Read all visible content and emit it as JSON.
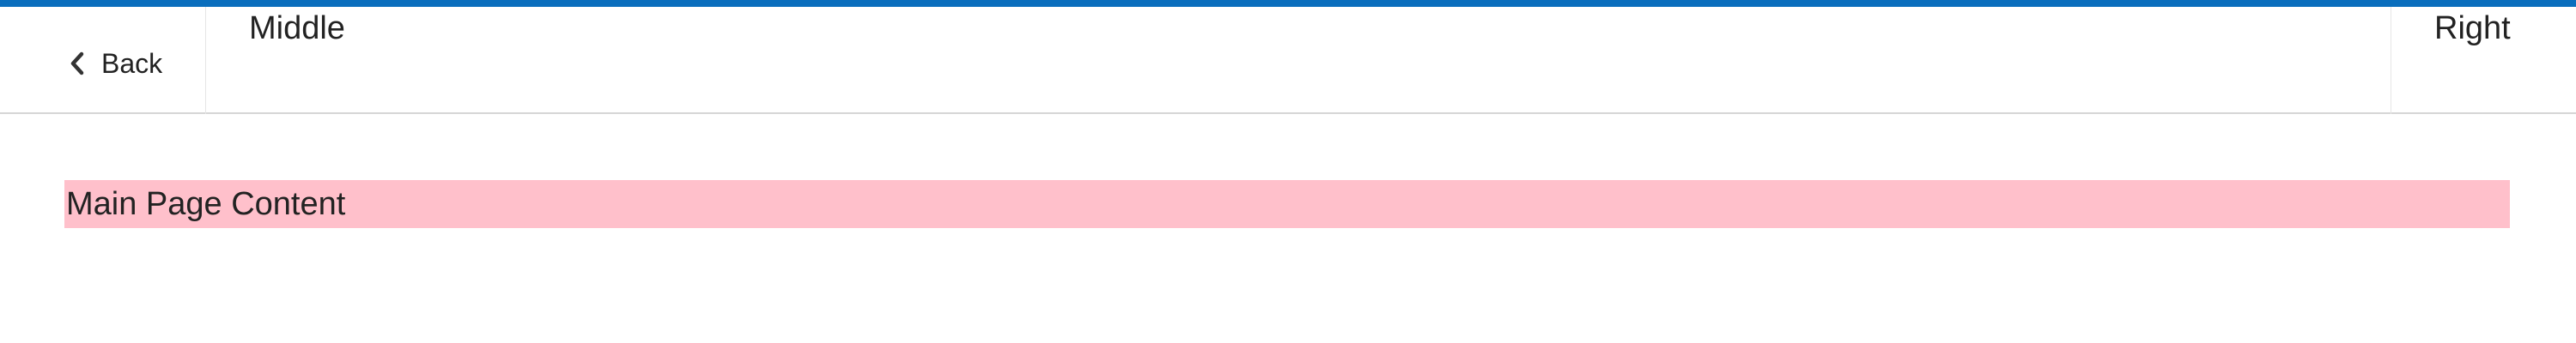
{
  "header": {
    "back_label": "Back",
    "middle_label": "Middle",
    "right_label": "Right",
    "accent_color": "#0a6ebd"
  },
  "main": {
    "content_text": "Main Page Content",
    "content_background": "#ffc0cb"
  },
  "icons": {
    "back": "chevron-left-icon"
  }
}
